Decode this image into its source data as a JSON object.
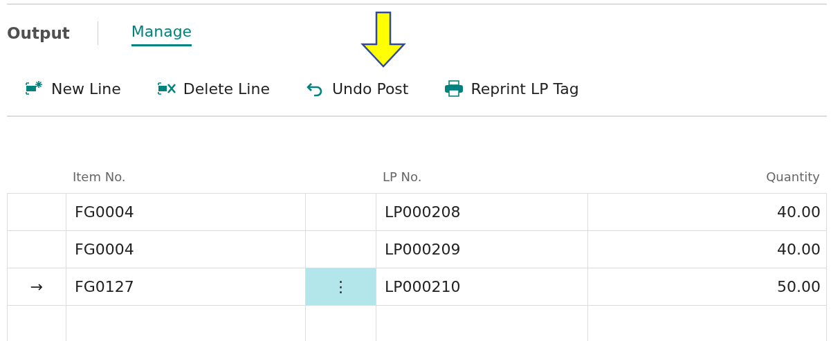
{
  "page_title": "Output",
  "tabs": [
    {
      "label": "Manage",
      "selected": true
    }
  ],
  "actions": [
    {
      "kind": "new-line",
      "label": "New Line"
    },
    {
      "kind": "delete-line",
      "label": "Delete Line"
    },
    {
      "kind": "undo",
      "label": "Undo Post"
    },
    {
      "kind": "print",
      "label": "Reprint LP Tag"
    }
  ],
  "annotation": {
    "kind": "down-arrow",
    "color": "#ffff00"
  },
  "table": {
    "columns": [
      "Item No.",
      "LP No.",
      "Quantity"
    ],
    "rows": [
      {
        "marker": null,
        "item_no": "FG0004",
        "lp_no": "LP000208",
        "quantity": "40.00",
        "selected": false
      },
      {
        "marker": null,
        "item_no": "FG0004",
        "lp_no": "LP000209",
        "quantity": "40.00",
        "selected": false
      },
      {
        "marker": "→",
        "item_no": "FG0127",
        "lp_no": "LP000210",
        "quantity": "50.00",
        "selected": true,
        "menu": "⋮"
      }
    ]
  }
}
